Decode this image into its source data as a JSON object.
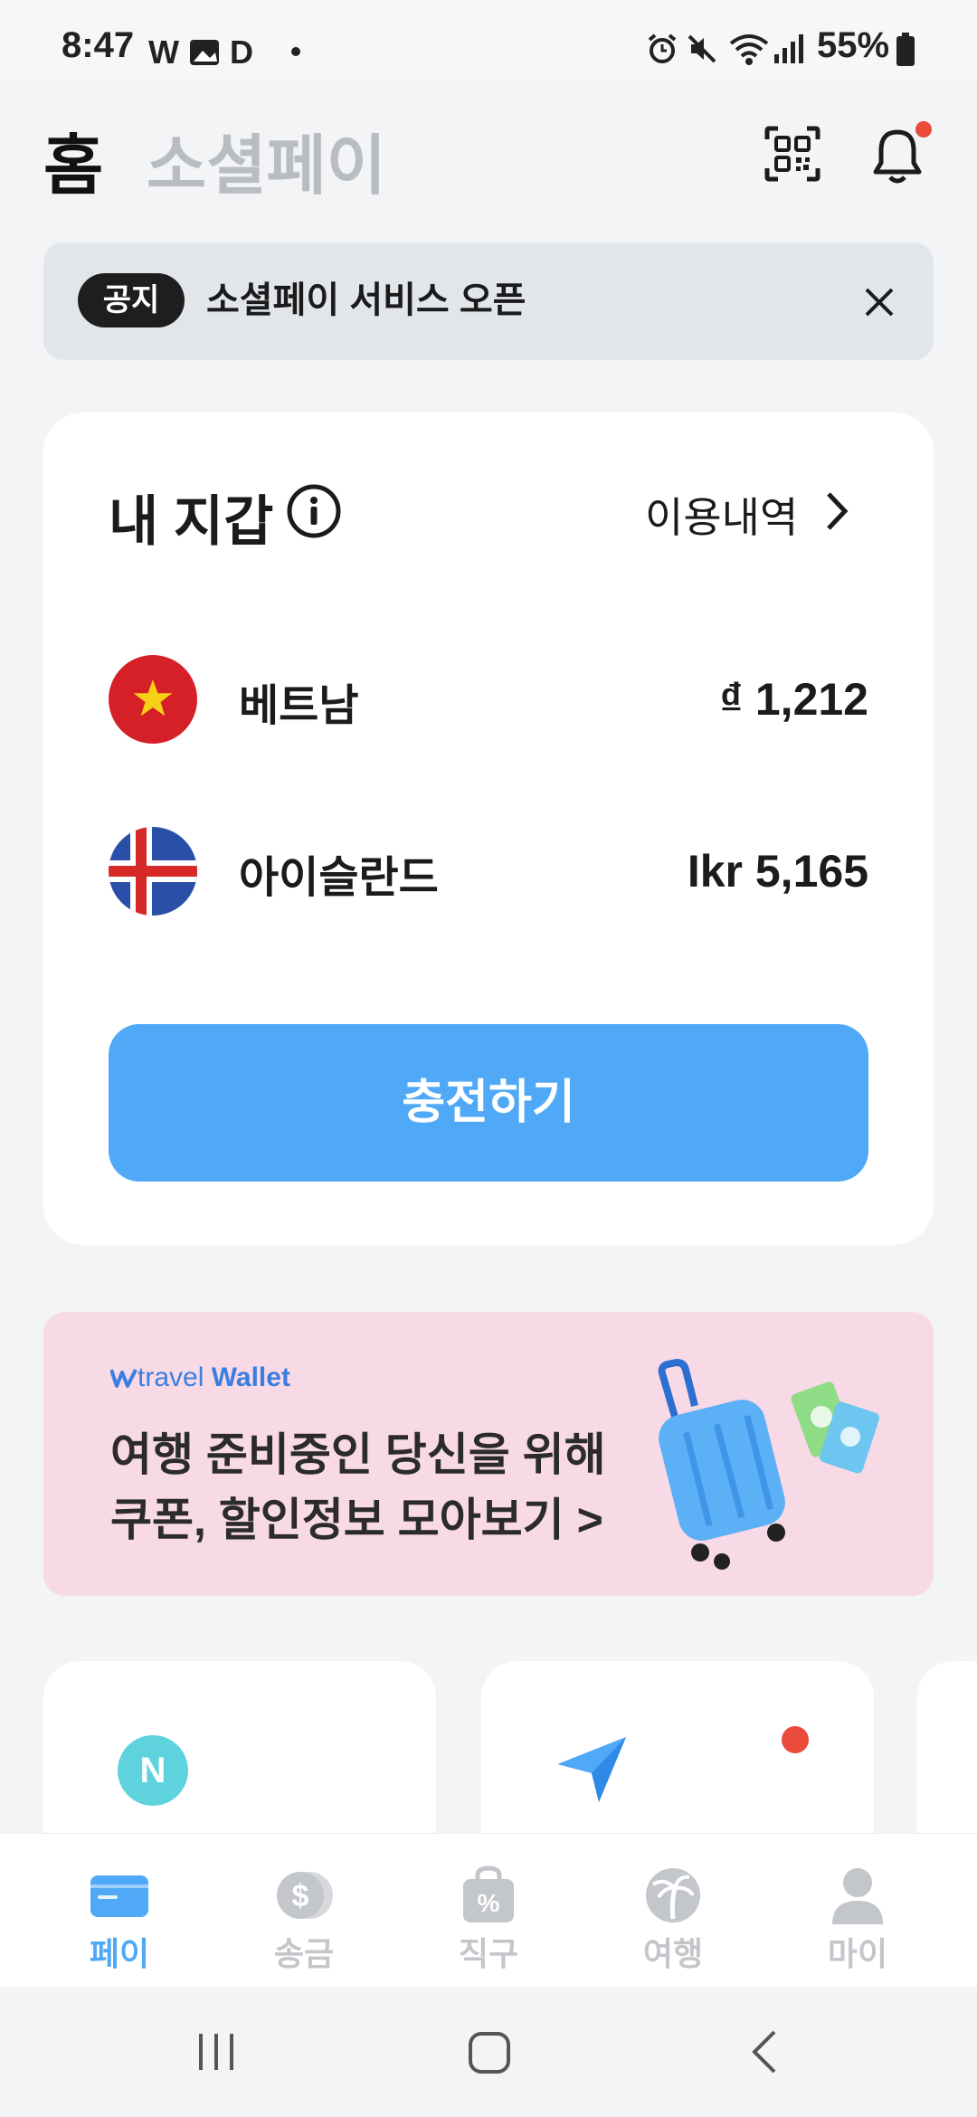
{
  "status_bar": {
    "time": "8:47",
    "battery": "55%"
  },
  "header": {
    "tab_home": "홈",
    "tab_social_pay": "소셜페이"
  },
  "notice": {
    "badge": "공지",
    "text": "소셜페이 서비스 오픈"
  },
  "wallet": {
    "title": "내 지갑",
    "history_link": "이용내역",
    "accounts": [
      {
        "name": "베트남",
        "amount": "₫ 1,212"
      },
      {
        "name": "아이슬란드",
        "amount": "Ikr 5,165"
      }
    ],
    "charge_button": "충전하기"
  },
  "banner": {
    "brand_prefix": "travel",
    "brand_suffix": "Wallet",
    "line1": "여행 준비중인 당신을 위해",
    "line2": "쿠폰, 할인정보 모아보기 >"
  },
  "service_cards": [
    {
      "badge": "N"
    }
  ],
  "bottom_nav": [
    {
      "label": "페이",
      "active": true
    },
    {
      "label": "송금",
      "active": false
    },
    {
      "label": "직구",
      "active": false
    },
    {
      "label": "여행",
      "active": false
    },
    {
      "label": "마이",
      "active": false
    }
  ],
  "colors": {
    "accent": "#4fa9f7",
    "banner_bg": "#f8d9e6",
    "notification_dot": "#ea4b3a"
  }
}
